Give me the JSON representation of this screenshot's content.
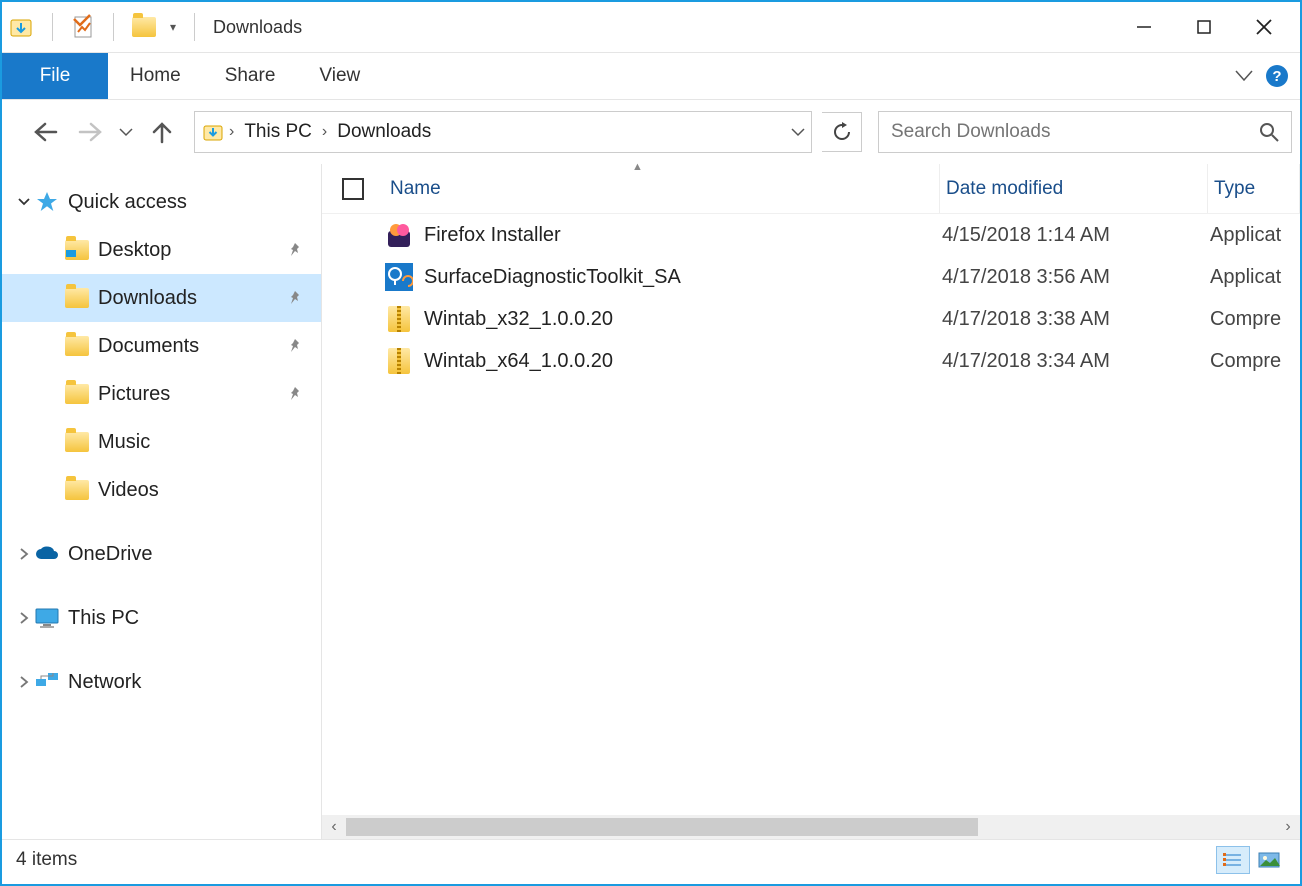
{
  "window": {
    "title": "Downloads"
  },
  "ribbon": {
    "file": "File",
    "tabs": [
      "Home",
      "Share",
      "View"
    ]
  },
  "breadcrumb": {
    "root": "This PC",
    "current": "Downloads"
  },
  "search": {
    "placeholder": "Search Downloads"
  },
  "sidebar": {
    "quick_access": "Quick access",
    "items": [
      {
        "label": "Desktop",
        "pinned": true
      },
      {
        "label": "Downloads",
        "pinned": true,
        "selected": true
      },
      {
        "label": "Documents",
        "pinned": true
      },
      {
        "label": "Pictures",
        "pinned": true
      },
      {
        "label": "Music",
        "pinned": false
      },
      {
        "label": "Videos",
        "pinned": false
      }
    ],
    "onedrive": "OneDrive",
    "thispc": "This PC",
    "network": "Network"
  },
  "columns": {
    "name": "Name",
    "date": "Date modified",
    "type": "Type"
  },
  "files": [
    {
      "name": "Firefox Installer",
      "date": "4/15/2018 1:14 AM",
      "type": "Applicat"
    },
    {
      "name": "SurfaceDiagnosticToolkit_SA",
      "date": "4/17/2018 3:56 AM",
      "type": "Applicat"
    },
    {
      "name": "Wintab_x32_1.0.0.20",
      "date": "4/17/2018 3:38 AM",
      "type": "Compre"
    },
    {
      "name": "Wintab_x64_1.0.0.20",
      "date": "4/17/2018 3:34 AM",
      "type": "Compre"
    }
  ],
  "status": {
    "text": "4 items"
  }
}
